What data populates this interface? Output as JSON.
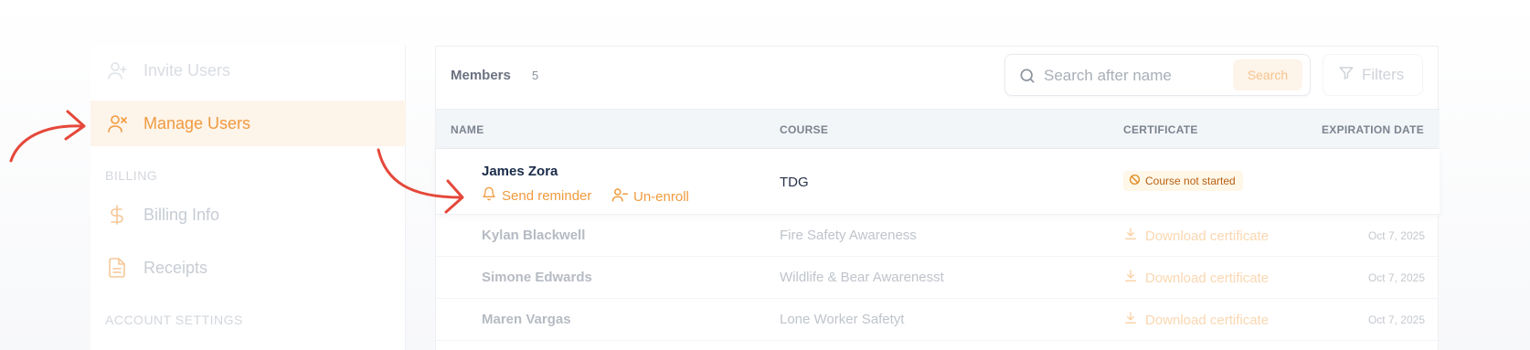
{
  "sidebar": {
    "items": [
      {
        "label": "Invite Users",
        "icon": "user-plus-icon"
      },
      {
        "label": "Manage Users",
        "icon": "user-remove-icon",
        "active": true
      },
      {
        "label": "Billing Info",
        "icon": "dollar-icon"
      },
      {
        "label": "Receipts",
        "icon": "document-icon"
      }
    ],
    "sections": {
      "billing": "BILLING",
      "account": "ACCOUNT SETTINGS"
    }
  },
  "toolbar": {
    "members_label": "Members",
    "members_count": "5",
    "search_placeholder": "Search after name",
    "search_button": "Search",
    "filters_label": "Filters"
  },
  "table": {
    "headers": {
      "name": "NAME",
      "course": "COURSE",
      "certificate": "CERTIFICATE",
      "expiration": "EXPIRATION DATE"
    },
    "highlighted_row": {
      "name": "James Zora",
      "course": "TDG",
      "status": "Course not started",
      "actions": {
        "reminder": "Send reminder",
        "unenroll": "Un-enroll"
      }
    },
    "rows": [
      {
        "name": "Kylan Blackwell",
        "course": "Fire Safety Awareness",
        "certificate": "Download certificate",
        "expiration": "Oct 7, 2025"
      },
      {
        "name": "Simone Edwards",
        "course": "Wildlife & Bear Awarenesst",
        "certificate": "Download certificate",
        "expiration": "Oct 7, 2025"
      },
      {
        "name": "Maren Vargas",
        "course": "Lone Worker Safetyt",
        "certificate": "Download certificate",
        "expiration": "Oct 7, 2025"
      }
    ]
  },
  "colors": {
    "accent": "#f19a3e",
    "annotation_arrow": "#e5483a",
    "badge_bg": "#fff7e8",
    "badge_text": "#b85f12"
  }
}
